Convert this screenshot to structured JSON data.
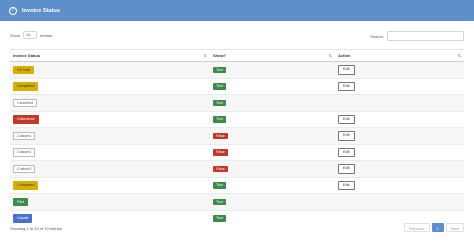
{
  "header": {
    "title": "Invoice Status"
  },
  "controls": {
    "show_label": "Show",
    "entries_value": "10",
    "entries_label": "entries",
    "search_label": "Search:",
    "search_value": ""
  },
  "table": {
    "columns": [
      "Invoice Status",
      "Show?",
      "Action"
    ],
    "rows": [
      {
        "status": "On Hold",
        "badge_bg": "#d4b100",
        "badge_fg": "#333333",
        "badge_border": "#d4b100",
        "show": "True",
        "show_bg": "#3f8a4a",
        "action": "Edit"
      },
      {
        "status": "Completed",
        "badge_bg": "#d4b100",
        "badge_fg": "#333333",
        "badge_border": "#d4b100",
        "show": "True",
        "show_bg": "#3f8a4a",
        "action": "Edit"
      },
      {
        "status": "Cancelled",
        "badge_bg": "#ffffff",
        "badge_fg": "#555555",
        "badge_border": "#bbbbbb",
        "show": "True",
        "show_bg": "#3f8a4a",
        "action": ""
      },
      {
        "status": "Collections",
        "badge_bg": "#c0392b",
        "badge_fg": "#ffffff",
        "badge_border": "#c0392b",
        "show": "True",
        "show_bg": "#3f8a4a",
        "action": "Edit"
      },
      {
        "status": "Custom1",
        "badge_bg": "#ffffff",
        "badge_fg": "#555555",
        "badge_border": "#bbbbbb",
        "show": "False",
        "show_bg": "#c0392b",
        "action": "Edit"
      },
      {
        "status": "Custom2",
        "badge_bg": "#ffffff",
        "badge_fg": "#555555",
        "badge_border": "#bbbbbb",
        "show": "False",
        "show_bg": "#c0392b",
        "action": "Edit"
      },
      {
        "status": "Custom3",
        "badge_bg": "#ffffff",
        "badge_fg": "#555555",
        "badge_border": "#bbbbbb",
        "show": "False",
        "show_bg": "#c0392b",
        "action": "Edit"
      },
      {
        "status": "Completed",
        "badge_bg": "#d4b100",
        "badge_fg": "#333333",
        "badge_border": "#d4b100",
        "show": "True",
        "show_bg": "#3f8a4a",
        "action": "Edit"
      },
      {
        "status": "Paid",
        "badge_bg": "#3f8a4a",
        "badge_fg": "#ffffff",
        "badge_border": "#3f8a4a",
        "show": "True",
        "show_bg": "#3f8a4a",
        "action": ""
      },
      {
        "status": "Unpaid",
        "badge_bg": "#4a6fd1",
        "badge_fg": "#ffffff",
        "badge_border": "#4a6fd1",
        "show": "True",
        "show_bg": "#3f8a4a",
        "action": ""
      }
    ]
  },
  "footer": {
    "info": "Showing 1 to 10 of 10 entries",
    "previous": "Previous",
    "page": "1",
    "next": "Next"
  }
}
